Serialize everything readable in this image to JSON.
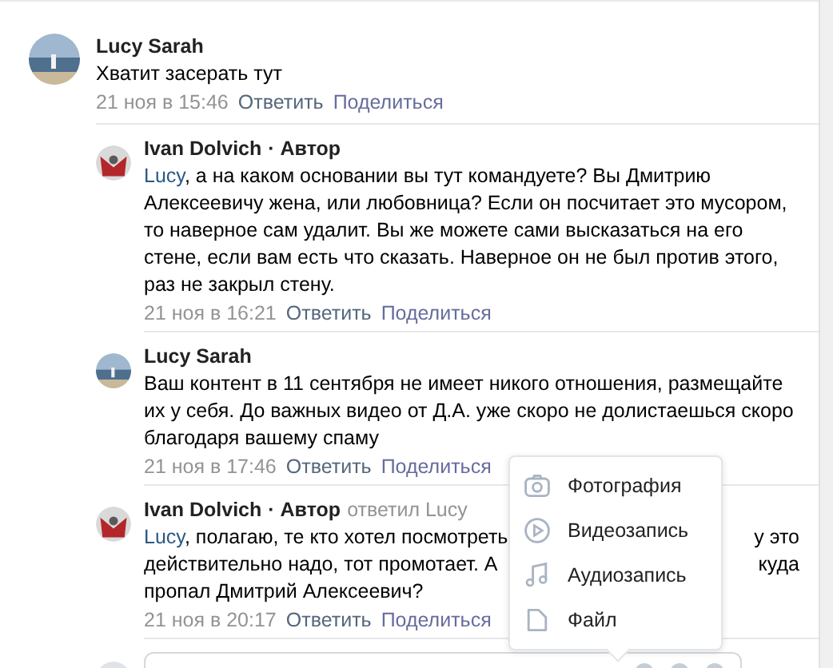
{
  "comments": [
    {
      "author": "Lucy Sarah",
      "text": "Хватит засерать тут",
      "date": "21 ноя в 15:46",
      "reply_label": "Ответить",
      "share_label": "Поделиться",
      "children": [
        {
          "author": "Ivan Dolvich",
          "badge": "· Автор",
          "address": "Lucy",
          "text": ", а на каком основании вы тут командуете? Вы Дмитрию Алексеевичу жена, или любовница? Если он посчитает это мусором, то наверное сам удалит. Вы же можете сами высказаться на его стене, если вам есть что сказать. Наверное он не был против этого, раз не закрыл стену.",
          "date": "21 ноя в 16:21",
          "reply_label": "Ответить",
          "share_label": "Поделиться"
        },
        {
          "author": "Lucy Sarah",
          "text": "Ваш контент в 11 сентября не имеет никого отношения, размещайте их у себя. До важных видео от Д.А. уже скоро не долистаешься скоро благодаря вашему спаму",
          "date": "21 ноя в 17:46",
          "reply_label": "Ответить",
          "share_label": "Поделиться"
        },
        {
          "author": "Ivan Dolvich",
          "badge": "· Автор",
          "reply_note": "ответил Lucy",
          "address": "Lucy",
          "text_lines": [
            {
              "left": ", полагаю, те кто хотел посмотреть",
              "right": "у это"
            },
            {
              "left": "действительно надо, тот промотает. А",
              "right": "куда"
            },
            {
              "left": "пропал Дмитрий Алексеевич?"
            }
          ],
          "date": "21 ноя в 20:17",
          "reply_label": "Ответить",
          "share_label": "Поделиться"
        }
      ]
    }
  ],
  "attach_menu": [
    {
      "label": "Фотография"
    },
    {
      "kind": "video",
      "label": "Видеозапись"
    },
    {
      "kind": "audio",
      "label": "Аудиозапись"
    },
    {
      "kind": "file",
      "label": "Файл"
    }
  ]
}
